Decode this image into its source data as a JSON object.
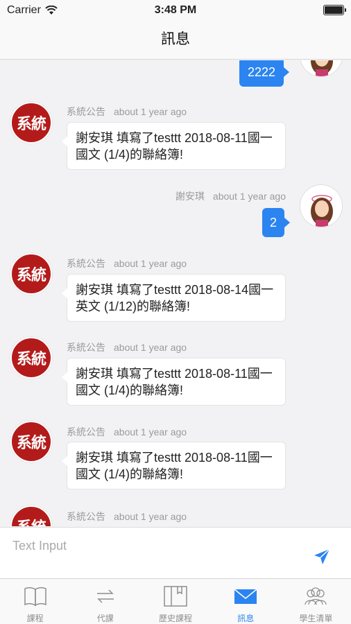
{
  "status_bar": {
    "carrier": "Carrier",
    "time": "3:48 PM"
  },
  "nav": {
    "title": "訊息"
  },
  "avatar_text": "系統",
  "messages": [
    {
      "type": "user",
      "text": "2222"
    },
    {
      "type": "system",
      "sender": "系統公告",
      "time": "about 1 year ago",
      "text": "謝安琪 填寫了testtt 2018-08-11國一 國文 (1/4)的聯絡簿!"
    },
    {
      "type": "user",
      "sender": "謝安琪",
      "time": "about 1 year ago",
      "text": "2"
    },
    {
      "type": "system",
      "sender": "系統公告",
      "time": "about 1 year ago",
      "text": "謝安琪 填寫了testtt 2018-08-14國一 英文 (1/12)的聯絡簿!"
    },
    {
      "type": "system",
      "sender": "系統公告",
      "time": "about 1 year ago",
      "text": "謝安琪 填寫了testtt 2018-08-11國一 國文 (1/4)的聯絡簿!"
    },
    {
      "type": "system",
      "sender": "系統公告",
      "time": "about 1 year ago",
      "text": "謝安琪 填寫了testtt 2018-08-11國一 國文 (1/4)的聯絡簿!"
    },
    {
      "type": "system",
      "sender": "系統公告",
      "time": "about 1 year ago",
      "text": ""
    }
  ],
  "input": {
    "placeholder": "Text Input"
  },
  "tabs": [
    {
      "label": "課程",
      "icon": "book-icon"
    },
    {
      "label": "代課",
      "icon": "swap-icon"
    },
    {
      "label": "歷史課程",
      "icon": "history-book-icon"
    },
    {
      "label": "訊息",
      "icon": "mail-icon",
      "active": true
    },
    {
      "label": "學生清單",
      "icon": "people-icon"
    }
  ],
  "colors": {
    "accent": "#2b84f0",
    "system_avatar": "#b31b1b"
  }
}
